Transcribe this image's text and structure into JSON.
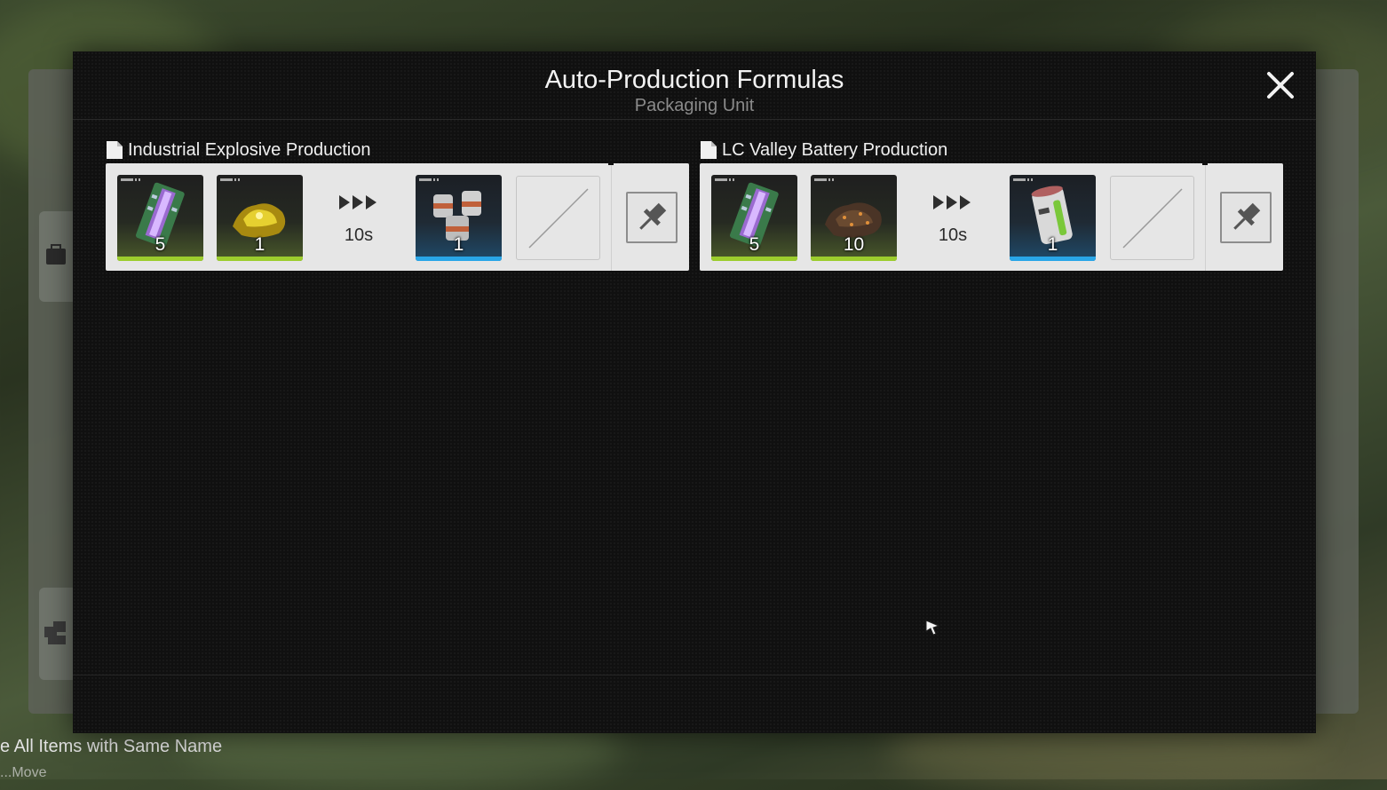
{
  "background": {
    "footer_text": "e All Items with Same Name",
    "footer_text_2": "...Move"
  },
  "dialog": {
    "title": "Auto-Production Formulas",
    "subtitle": "Packaging Unit"
  },
  "formulas": [
    {
      "name": "Industrial Explosive Production",
      "inputs": [
        {
          "item": "circuit-board-icon",
          "qty": "5"
        },
        {
          "item": "gold-ore-icon",
          "qty": "1"
        }
      ],
      "time": "10s",
      "output": {
        "item": "explosive-canisters-icon",
        "qty": "1"
      }
    },
    {
      "name": "LC Valley Battery Production",
      "inputs": [
        {
          "item": "circuit-board-icon",
          "qty": "5"
        },
        {
          "item": "dark-ore-icon",
          "qty": "10"
        }
      ],
      "time": "10s",
      "output": {
        "item": "battery-canister-icon",
        "qty": "1"
      }
    }
  ],
  "colors": {
    "input_bar": "#9ccd2d",
    "output_bar": "#29a6e8",
    "card_bg": "#e6e6e6",
    "dialog_bg": "#101010"
  }
}
